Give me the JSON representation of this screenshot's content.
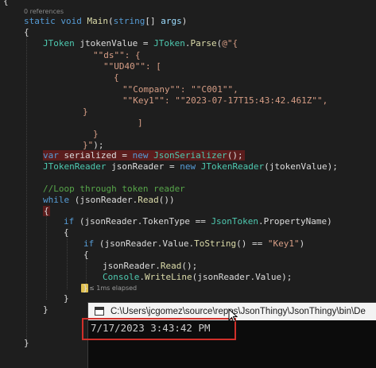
{
  "codelens": "0 references",
  "code": {
    "l1": {
      "kw1": "static",
      "kw2": "void",
      "fn": "Main",
      "p1": "(",
      "kw3": "string",
      "p2": "[] ",
      "par": "args",
      "p3": ")"
    },
    "l2": "{",
    "l3": {
      "ty1": "JToken",
      "t1": " jtokenValue = ",
      "ty2": "JToken",
      "t2": ".",
      "fn": "Parse",
      "t3": "(",
      "str": "@\"{"
    },
    "l4": "\"\"ds\"\": {",
    "l5": "\"\"UD40\"\": [",
    "l6": "{",
    "l7": "\"\"Company\"\": \"\"C001\"\",",
    "l8": "\"\"Key1\"\": \"\"2023-07-17T15:43:42.461Z\"\",",
    "l9": "}",
    "l10": "]",
    "l11": "}",
    "l12": {
      "str": "}\"",
      "t": ");"
    },
    "l13": {
      "kw1": "var",
      "t1": " serialized = ",
      "kw2": "new",
      "t2": " ",
      "ty": "JsonSerializer",
      "t3": "();"
    },
    "l14": {
      "ty1": "JTokenReader",
      "t1": " jsonReader = ",
      "kw": "new",
      "t2": " ",
      "ty2": "JTokenReader",
      "t3": "(jtokenValue);"
    },
    "l15": "//Loop through token reader",
    "l16": {
      "kw": "while",
      "t1": " (jsonReader.",
      "fn": "Read",
      "t2": "())"
    },
    "l17": "{",
    "l18": {
      "kw": "if",
      "t1": " (jsonReader.TokenType == ",
      "ty": "JsonToken",
      "t2": ".PropertyName)"
    },
    "l19": "{",
    "l20": {
      "kw": "if",
      "t1": " (jsonReader.Value.",
      "fn": "ToString",
      "t2": "() == ",
      "str": "\"Key1\"",
      "t3": ")"
    },
    "l21": "{",
    "l22": {
      "t1": "jsonReader.",
      "fn": "Read",
      "t2": "();"
    },
    "l23": {
      "ty": "Console",
      "t1": ".",
      "fn": "WriteLine",
      "t2": "(jsonReader.Value);"
    },
    "l24": "}",
    "l25": "}",
    "l26": "}",
    "l27": "}"
  },
  "elapsed": "≤ 1ms elapsed",
  "console": {
    "title": "C:\\Users\\jcgomez\\source\\repos\\JsonThingy\\JsonThingy\\bin\\De",
    "output": "7/17/2023 3:43:42 PM"
  }
}
